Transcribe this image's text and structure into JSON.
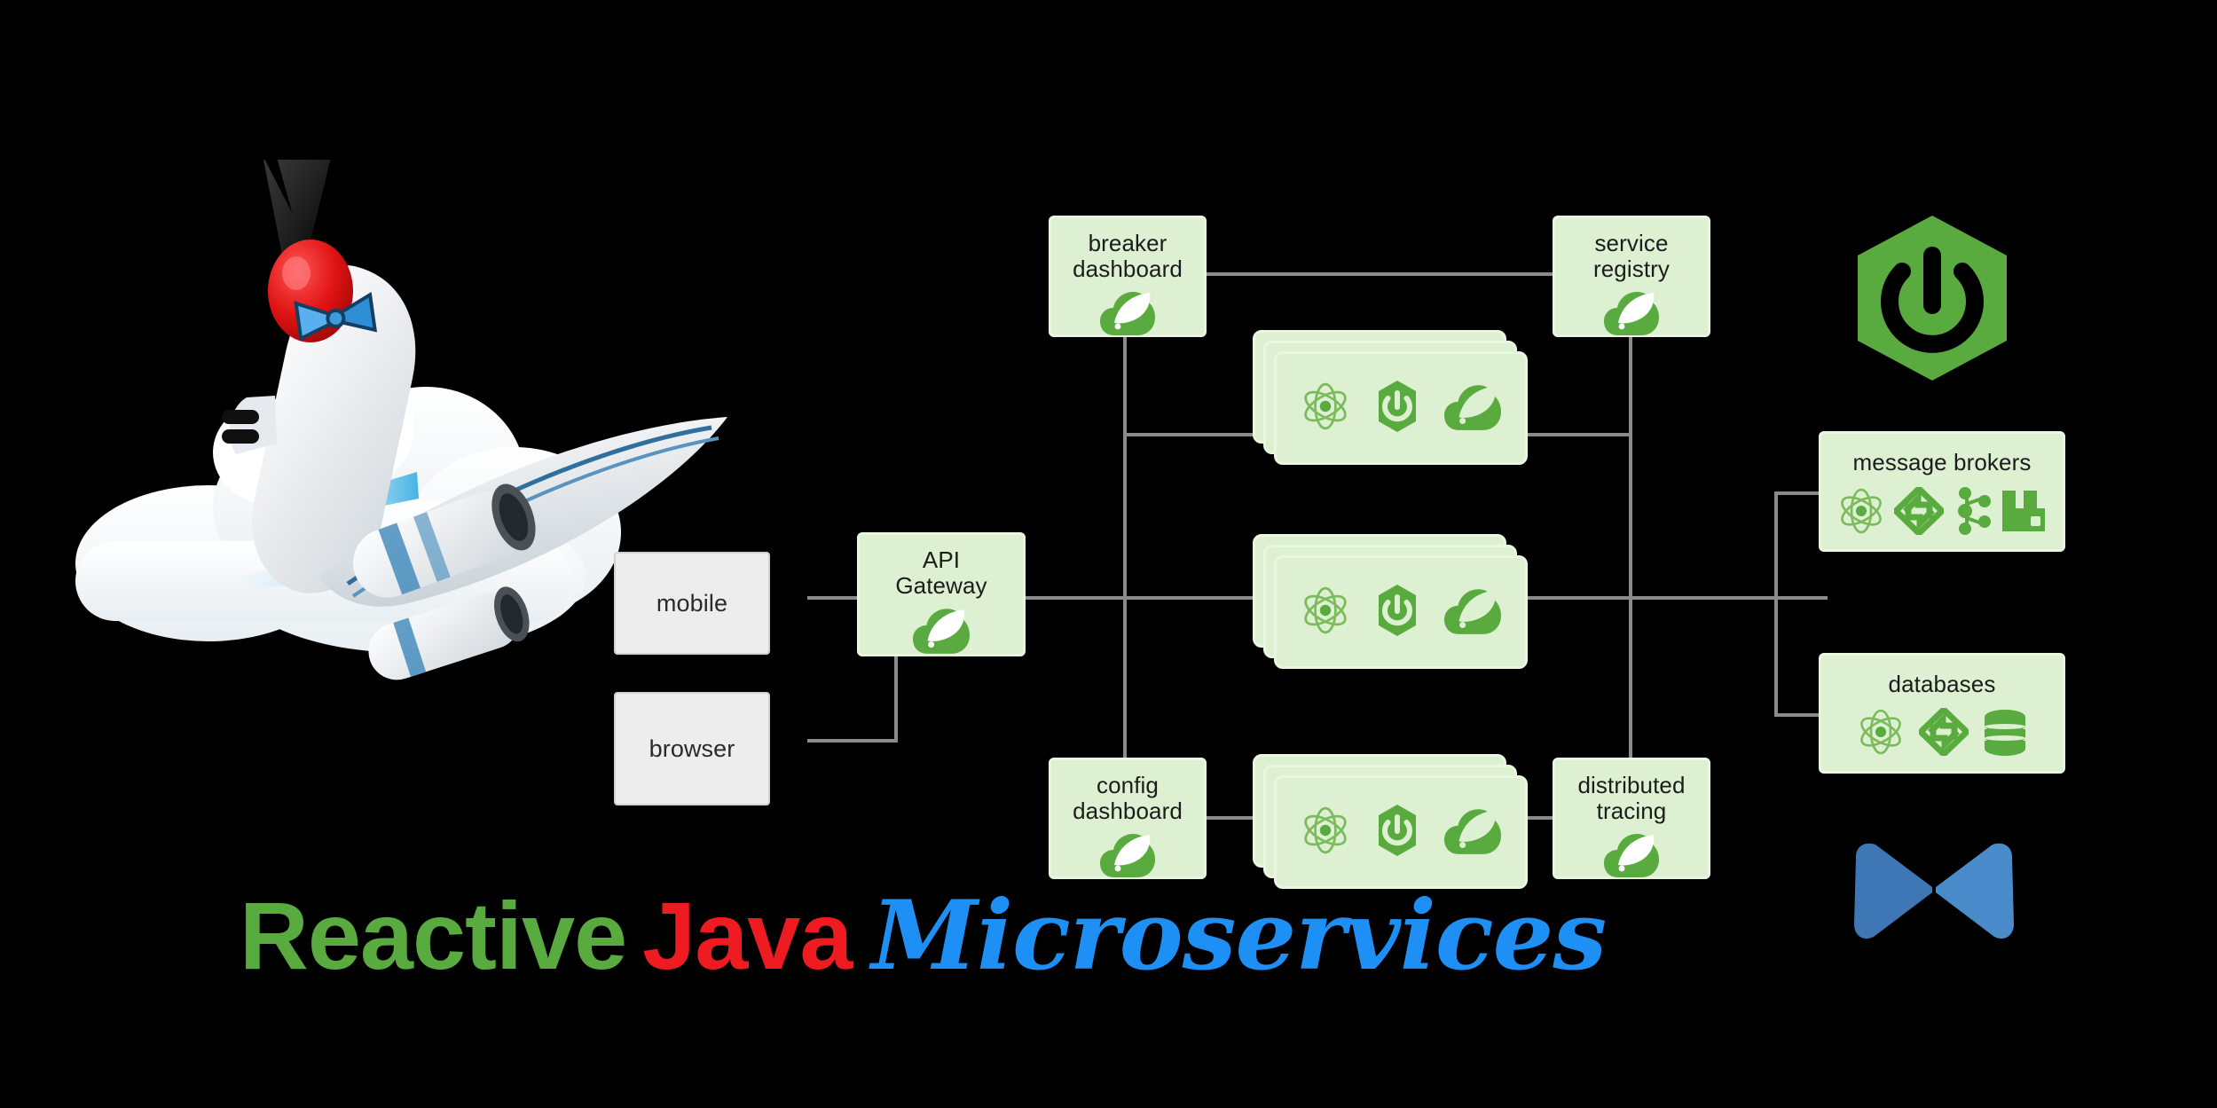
{
  "title": {
    "word1": "Reactive",
    "word2": "Java",
    "word3": "Microservices"
  },
  "colors": {
    "green_accent": "#5aab3f",
    "node_fill": "#ddf0d1",
    "node_border": "#e9f7e1",
    "plain_fill": "#ededed",
    "plain_border": "#d2d2d2",
    "connector": "#8a8a8a",
    "title_green": "#5aab3f",
    "title_red": "#ee1b20",
    "title_blue": "#1e90f5",
    "reactor_blue": "#3f76b5",
    "background": "#000000"
  },
  "diagram": {
    "clients": [
      {
        "id": "mobile",
        "label": "mobile"
      },
      {
        "id": "browser",
        "label": "browser"
      }
    ],
    "nodes": [
      {
        "id": "breaker-dashboard",
        "label": "breaker\ndashboard",
        "icons": [
          "spring-leaf-cloud-icon"
        ]
      },
      {
        "id": "service-registry",
        "label": "service\nregistry",
        "icons": [
          "spring-leaf-cloud-icon"
        ]
      },
      {
        "id": "api-gateway",
        "label": "API\nGateway",
        "icons": [
          "spring-leaf-cloud-icon"
        ]
      },
      {
        "id": "config-dashboard",
        "label": "config\ndashboard",
        "icons": [
          "spring-leaf-cloud-icon"
        ]
      },
      {
        "id": "distributed-tracing",
        "label": "distributed\ntracing",
        "icons": [
          "spring-leaf-cloud-icon"
        ]
      },
      {
        "id": "message-brokers",
        "label": "message brokers",
        "icons": [
          "reactor-atom-icon",
          "spring-cloud-stream-icon",
          "kafka-icon",
          "rabbitmq-icon"
        ]
      },
      {
        "id": "databases",
        "label": "databases",
        "icons": [
          "reactor-atom-icon",
          "spring-cloud-stream-icon",
          "database-cylinder-icon"
        ]
      }
    ],
    "service_decks": [
      {
        "id": "microservice-deck-top",
        "icons": [
          "reactor-atom-icon",
          "spring-boot-icon",
          "spring-leaf-cloud-icon"
        ]
      },
      {
        "id": "microservice-deck-middle",
        "icons": [
          "reactor-atom-icon",
          "spring-boot-icon",
          "spring-leaf-cloud-icon"
        ]
      },
      {
        "id": "microservice-deck-bottom",
        "icons": [
          "reactor-atom-icon",
          "spring-boot-icon",
          "spring-leaf-cloud-icon"
        ]
      }
    ],
    "standalone_logos": [
      {
        "id": "spring-boot-logo",
        "name": "spring-boot-icon"
      },
      {
        "id": "reactor-logo",
        "name": "project-reactor-icon"
      }
    ],
    "artwork": {
      "id": "duke-rocket-cloud",
      "name": "java-duke-riding-rocket-illustration"
    }
  }
}
